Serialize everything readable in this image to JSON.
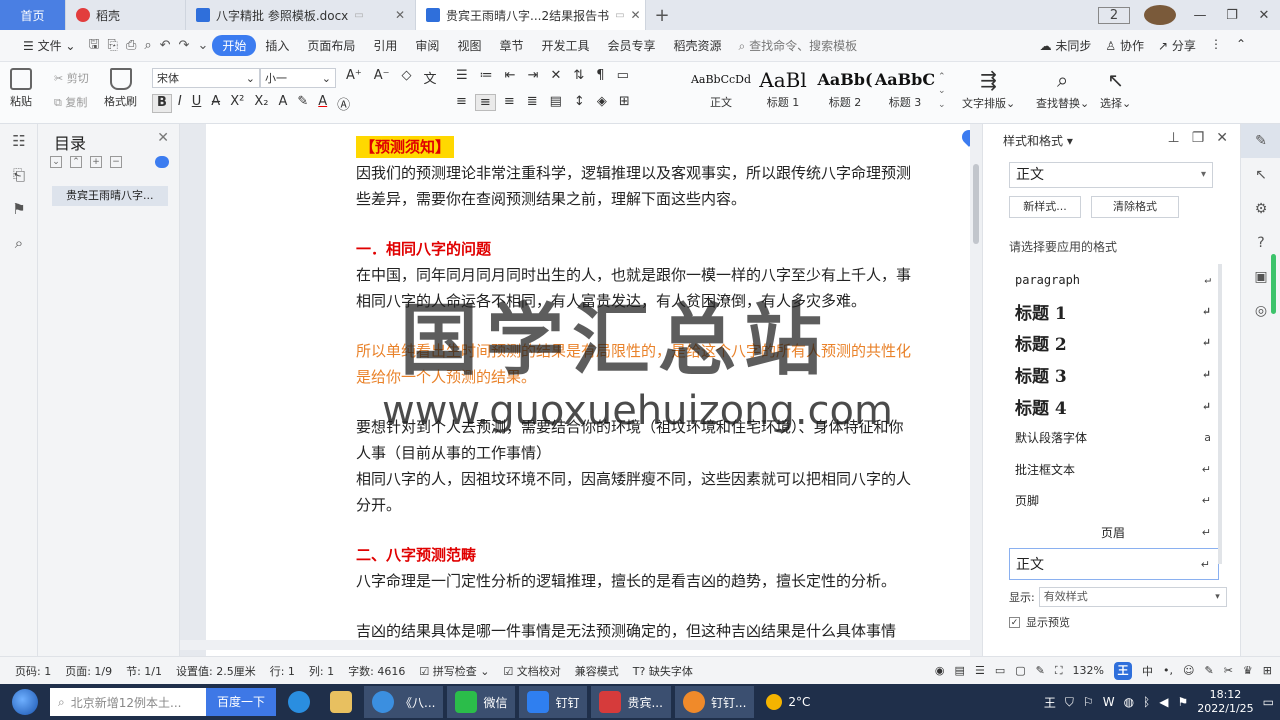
{
  "tabs": {
    "home": "首页",
    "daoke": "稻壳",
    "doc1": "八字精批 参照模板.docx",
    "doc2": "贵宾王雨晴八字...2结果报告书",
    "page_badge": "2"
  },
  "menu": {
    "file": "文件",
    "items": [
      "开始",
      "插入",
      "页面布局",
      "引用",
      "审阅",
      "视图",
      "章节",
      "开发工具",
      "会员专享",
      "稻壳资源"
    ],
    "search": "查找命令、搜索模板",
    "sync": "未同步",
    "collab": "协作",
    "share": "分享"
  },
  "ribbon": {
    "paste": "粘贴",
    "cut": "剪切",
    "copy": "复制",
    "format_painter": "格式刷",
    "font_name": "宋体",
    "font_size": "小一",
    "styles": [
      {
        "sample": "AaBbCcDd",
        "label": "正文"
      },
      {
        "sample": "AaBl",
        "label": "标题 1"
      },
      {
        "sample": "AaBb(",
        "label": "标题 2"
      },
      {
        "sample": "AaBbC",
        "label": "标题 3"
      }
    ],
    "text_layout": "文字排版",
    "find_replace": "查找替换",
    "select": "选择"
  },
  "toc": {
    "title": "目录",
    "item": "贵宾王雨晴八字..."
  },
  "doc": {
    "notice": "【预测须知】",
    "p1": "因我们的预测理论非常注重科学，逻辑推理以及客观事实，所以跟传统八字命理预测",
    "p2": "些差异，需要你在查阅预测结果之前，理解下面这些内容。",
    "h1": "一．相同八字的问题",
    "p3": "在中国，同年同月同月同时出生的人，也就是跟你一模一样的八字至少有上千人，事",
    "p4": "相同八字的人命运各不相同，有人富贵发达，有人贫困潦倒，有人多灾多难。",
    "p5": "所以单纯看出生时间预测的结果是有局限性的，是给这个八字的所有人预测的共性化",
    "p6": "是给你一个人预测的结果。",
    "p7": "要想针对到个人去预测，需要结合你的环境（祖坟环境和住宅环境）、身体特征和你",
    "p8": "人事（目前从事的工作事情）",
    "p9": "相同八字的人，因祖坟环境不同，因高矮胖瘦不同，这些因素就可以把相同八字的人",
    "p10": "分开。",
    "h2": "二、八字预测范畴",
    "p11": "八字命理是一门定性分析的逻辑推理，擅长的是看吉凶的趋势，擅长定性的分析。",
    "p12": "吉凶的结果具体是哪一件事情是无法预测确定的，但这种吉凶结果是什么具体事情"
  },
  "watermark": {
    "line1": "国学汇总站",
    "line2": "www.guoxuehuizong.com"
  },
  "panel": {
    "title": "样式和格式",
    "current": "正文",
    "new_style": "新样式...",
    "clear_format": "清除格式",
    "choose_label": "请选择要应用的格式",
    "list": [
      {
        "name": "paragraph",
        "kind": "para",
        "mark": "↵"
      },
      {
        "name": "标题 1",
        "kind": "h",
        "mark": "↵"
      },
      {
        "name": "标题 2",
        "kind": "h",
        "mark": "↵"
      },
      {
        "name": "标题 3",
        "kind": "h",
        "mark": "↵"
      },
      {
        "name": "标题 4",
        "kind": "h",
        "mark": "↵"
      },
      {
        "name": "默认段落字体",
        "kind": "small",
        "mark": "a"
      },
      {
        "name": "批注框文本",
        "kind": "small",
        "mark": "↵"
      },
      {
        "name": "页脚",
        "kind": "small",
        "mark": "↵"
      },
      {
        "name": "页眉",
        "kind": "center",
        "mark": "↵"
      },
      {
        "name": "正文",
        "kind": "sel",
        "mark": "↵"
      }
    ],
    "show_label": "显示:",
    "show_value": "有效样式",
    "preview_label": "显示预览"
  },
  "status": {
    "page_code": "页码: 1",
    "page": "页面: 1/9",
    "section": "节: 1/1",
    "setting": "设置值: 2.5厘米",
    "row": "行: 1",
    "col": "列: 1",
    "words": "字数: 4616",
    "spell": "拼写检查",
    "proof": "文档校对",
    "compat": "兼容模式",
    "missing_font": "缺失字体",
    "zoom": "132%"
  },
  "taskbar": {
    "search_placeholder": "北京新增12例本土...",
    "baidu": "百度一下",
    "apps": [
      "《八...",
      "微信",
      "钉钉",
      "贵宾...",
      "钉钉..."
    ],
    "weather": "2°C",
    "time": "18:12",
    "date": "2022/1/25"
  }
}
